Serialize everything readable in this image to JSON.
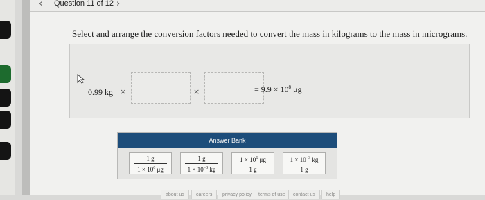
{
  "header": {
    "back_icon": "chevron-left-icon",
    "title": "Question 11 of 12",
    "forward_icon": "chevron-right-icon"
  },
  "question": {
    "instruction": "Select and arrange the conversion factors needed to convert the mass in kilograms to the mass in micrograms.",
    "given": "0.99 kg",
    "times_sign": "×",
    "result_prefix": "= 9.9 × 10",
    "result_exp": "8",
    "result_unit": " μg"
  },
  "answer_bank": {
    "title": "Answer Bank",
    "tiles": [
      {
        "top": "1 g",
        "bottom": "1 × 10",
        "bottom_exp": "6",
        "bottom_unit": " μg"
      },
      {
        "top": "1 g",
        "bottom": "1 × 10",
        "bottom_exp": "−3",
        "bottom_unit": " kg"
      },
      {
        "top": "1 × 10",
        "top_exp": "6",
        "top_unit": " μg",
        "bottom": "1 g"
      },
      {
        "top": "1 × 10",
        "top_exp": "−3",
        "top_unit": " kg",
        "bottom": "1 g"
      }
    ]
  },
  "footer": {
    "links": [
      "about us",
      "careers",
      "privacy policy",
      "terms of use",
      "contact us",
      "help"
    ]
  }
}
